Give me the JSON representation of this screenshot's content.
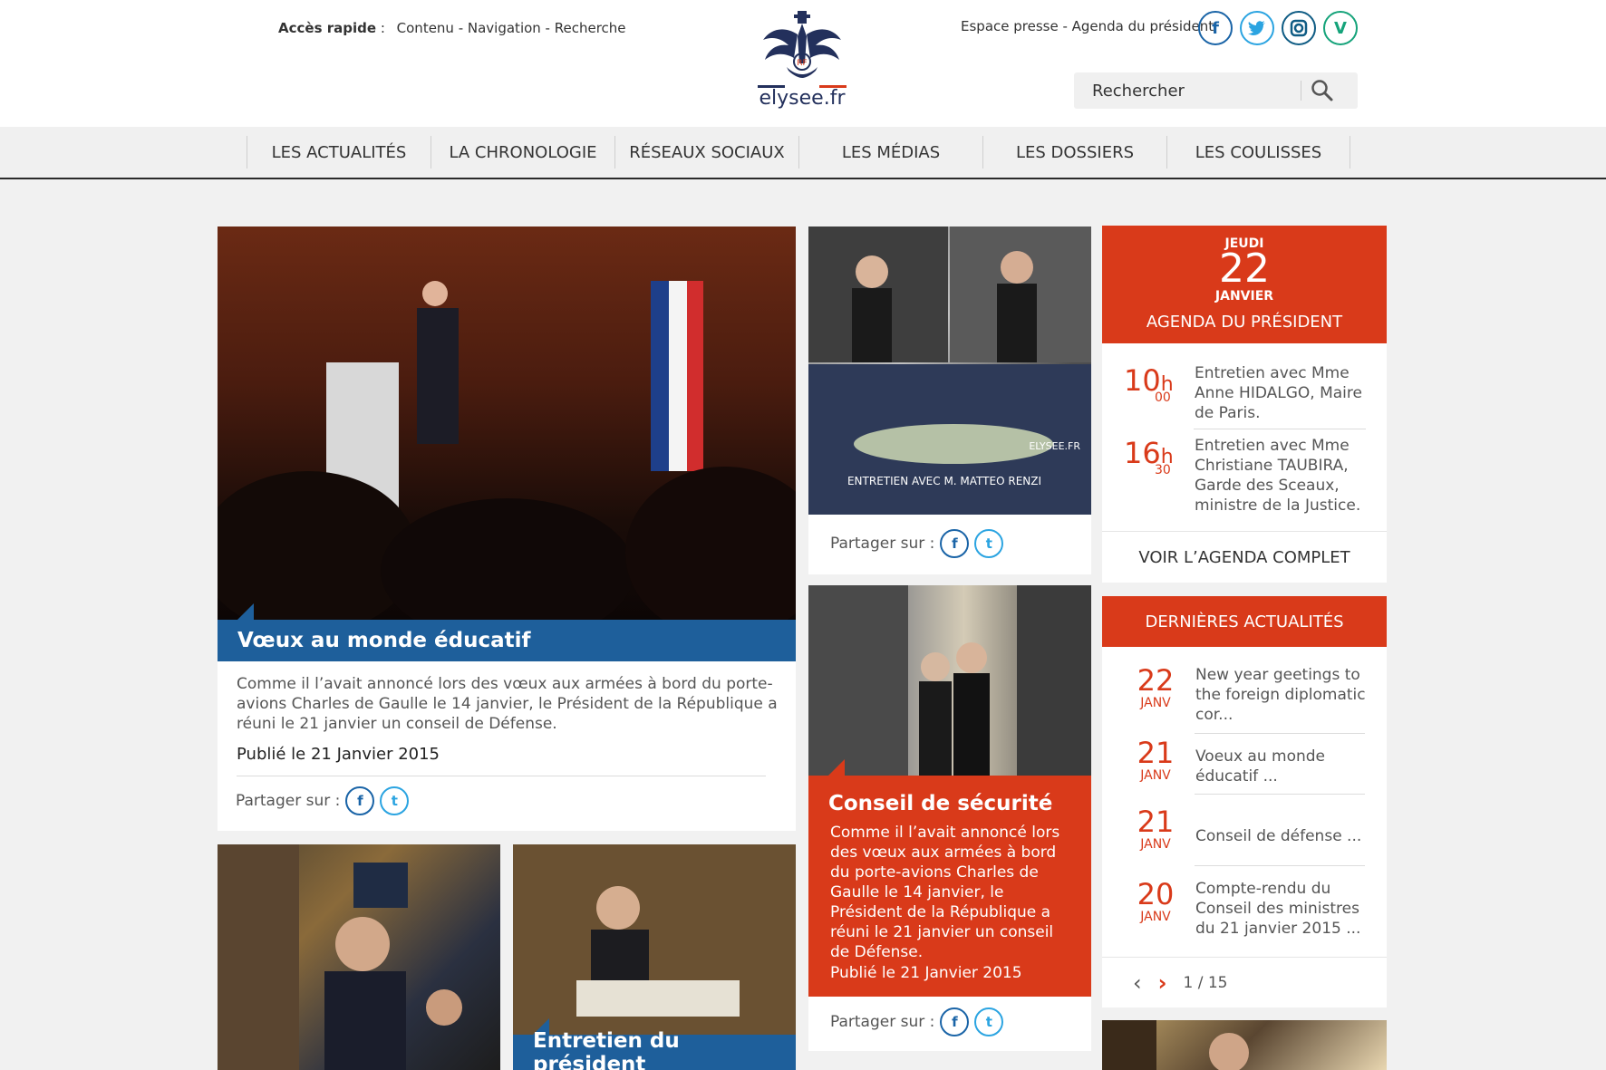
{
  "header": {
    "quick_label": "Accès rapide",
    "quick_sep": ":",
    "quick_links": "Contenu - Navigation - Recherche",
    "logo_text": "elysee.fr",
    "press_link": "Espace presse - Agenda du président",
    "search_placeholder": "Rechercher"
  },
  "nav": {
    "items": [
      "LES ACTUALITÉS",
      "LA CHRONOLOGIE",
      "RÉSEAUX SOCIAUX",
      "LES MÉDIAS",
      "LES DOSSIERS",
      "LES COULISSES"
    ]
  },
  "feature": {
    "title": "Vœux au monde éducatif",
    "description": "Comme il l’avait annoncé lors des vœux aux armées à bord du porte-avions Charles de Gaulle le 14 janvier, le Président de la République a réuni le 21 janvier un conseil de Défense.",
    "published": "Publié le 21 Janvier 2015",
    "share_label": "Partager sur :"
  },
  "video": {
    "caption": "ENTRETIEN AVEC M. MATTEO RENZI",
    "watermark": "ELYSEE.FR",
    "share_label": "Partager sur :"
  },
  "security": {
    "title": "Conseil de sécurité",
    "description": "Comme il l’avait annoncé lors des vœux aux armées à bord du porte-avions Charles de Gaulle le 14 janvier, le Président de la République a réuni le 21 janvier un conseil de Défense.",
    "published": "Publié le 21 Janvier 2015",
    "share_label": "Partager sur :"
  },
  "bottom": {
    "title": "Entretien du président"
  },
  "agenda": {
    "day_name": "JEUDI",
    "day": "22",
    "month": "JANVIER",
    "title": "AGENDA DU PRÉSIDENT",
    "items": [
      {
        "hour": "10",
        "minutes": "00",
        "text": "Entretien avec Mme Anne HIDALGO, Maire de Paris."
      },
      {
        "hour": "16",
        "minutes": "30",
        "text": "Entretien avec Mme Christiane TAUBIRA, Garde des Sceaux, ministre de la Justice."
      }
    ],
    "h_suffix": "h",
    "more": "VOIR L’AGENDA COMPLET"
  },
  "news": {
    "title": "DERNIÈRES ACTUALITÉS",
    "items": [
      {
        "day": "22",
        "month": "JANV",
        "text": "New year geetings to the foreign diplomatic cor..."
      },
      {
        "day": "21",
        "month": "JANV",
        "text": "Voeux au monde éducatif ..."
      },
      {
        "day": "21",
        "month": "JANV",
        "text": "Conseil de défense ..."
      },
      {
        "day": "20",
        "month": "JANV",
        "text": "Compte-rendu du Conseil des ministres du 21 janvier 2015 ..."
      }
    ],
    "pager": "1 / 15"
  },
  "colors": {
    "accent_red": "#d93a1a",
    "accent_blue": "#1e5f9b"
  },
  "icons": [
    "facebook-icon",
    "twitter-icon",
    "instagram-icon",
    "vine-icon",
    "search-icon",
    "chevron-left-icon",
    "chevron-right-icon"
  ]
}
